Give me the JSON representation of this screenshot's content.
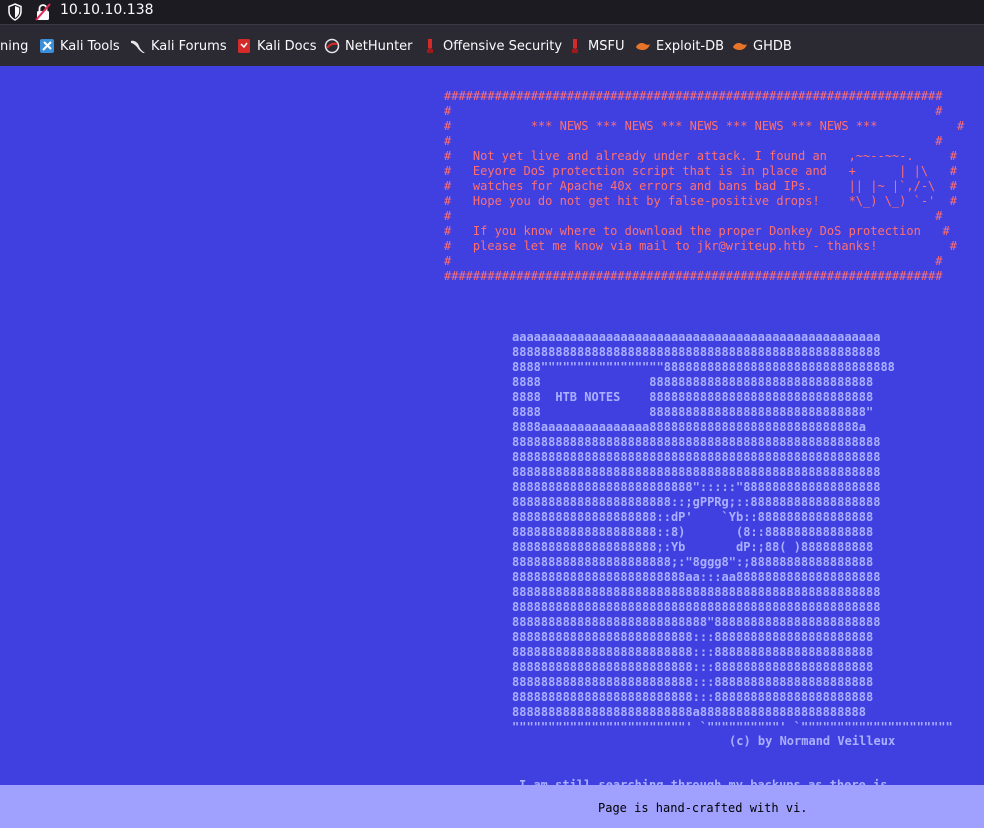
{
  "browser": {
    "url": "10.10.10.138",
    "bookmarks": [
      {
        "label": "ning",
        "icon": "none"
      },
      {
        "label": "Kali Tools",
        "icon": "kali-tools-icon"
      },
      {
        "label": "Kali Forums",
        "icon": "kali-dragon-icon"
      },
      {
        "label": "Kali Docs",
        "icon": "kali-docs-icon"
      },
      {
        "label": "NetHunter",
        "icon": "nethunter-icon"
      },
      {
        "label": "Offensive Security",
        "icon": "offsec-icon"
      },
      {
        "label": "MSFU",
        "icon": "msfu-icon"
      },
      {
        "label": "Exploit-DB",
        "icon": "exploit-db-icon"
      },
      {
        "label": "GHDB",
        "icon": "ghdb-icon"
      }
    ]
  },
  "news_box": "#####################################################################\n#                                                                   #\n#           *** NEWS *** NEWS *** NEWS *** NEWS *** NEWS ***           #\n#                                                                   #\n#   Not yet live and already under attack. I found an   ,~~--~~-.     #\n#   Eeyore DoS protection script that is in place and   +      | |\\   #\n#   watches for Apache 40x errors and bans bad IPs.     || |~ |`,/-\\  #\n#   Hope you do not get hit by false-positive drops!    *\\_) \\_) `-'  #\n#                                                                   #\n#   If you know where to download the proper Donkey DoS protection   #\n#   please let me know via mail to jkr@writeup.htb - thanks!          #\n#                                                                   #\n#####################################################################",
  "ascii_art": "aaaaaaaaaaaaaaaaaaaaaaaaaaaaaaaaaaaaaaaaaaaaaaaaaaa\n888888888888888888888888888888888888888888888888888\n8888\"\"\"\"\"\"\"\"\"\"\"\"\"\"\"\"\"88888888888888888888888888888888\n8888               8888888888888888888888888888888\n8888  HTB NOTES    8888888888888888888888888888888\n8888               888888888888888888888888888888\"\n8888aaaaaaaaaaaaaaa88888888888888888888888888888a\n888888888888888888888888888888888888888888888888888\n888888888888888888888888888888888888888888888888888\n888888888888888888888888888888888888888888888888888\n8888888888888888888888888\":::::\"8888888888888888888\n8888888888888888888888::;gPPRg;::888888888888888888\n88888888888888888888::dP'    `Yb::8888888888888888\n88888888888888888888::8)       (8::888888888888888\n88888888888888888888;:Yb       dP:;88( )8888888888\n8888888888888888888888;:\"8ggg8\":;88888888888888888\n888888888888888888888888aa:::aa88888888888888888888\n888888888888888888888888888888888888888888888888888\n888888888888888888888888888888888888888888888888888\n888888888888888888888888888\"88888888888888888888888\n8888888888888888888888888:::8888888888888888888888\n8888888888888888888888888:::8888888888888888888888\n8888888888888888888888888:::8888888888888888888888\n8888888888888888888888888:::8888888888888888888888\n8888888888888888888888888:::8888888888888888888888\n8888888888888888888888888a88888888888888888888888\n\"\"\"\"\"\"\"\"\"\"\"\"\"\"\"\"\"\"\"\"\"\"\"\"' `\"\"\"\"\"\"\"\"\"\"' `\"\"\"\"\"\"\"\"\"\"\"\"\"\"\"\"\"\"\"\"\"",
  "credit": "(c) by Normand Veilleux",
  "partial_text": "I am still searching through my backups as there is",
  "footer": "Page is hand-crafted with vi."
}
